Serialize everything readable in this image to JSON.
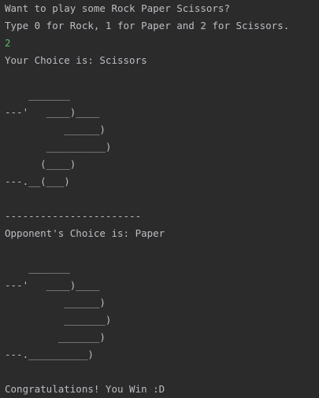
{
  "console": {
    "lines": [
      {
        "text": "Want to play some Rock Paper Scissors?",
        "kind": "output"
      },
      {
        "text": "Type 0 for Rock, 1 for Paper and 2 for Scissors.",
        "kind": "output"
      },
      {
        "text": "2",
        "kind": "input"
      },
      {
        "text": "Your Choice is: Scissors",
        "kind": "output"
      },
      {
        "text": "",
        "kind": "output"
      },
      {
        "text": "    _______",
        "kind": "output"
      },
      {
        "text": "---'   ____)____",
        "kind": "output"
      },
      {
        "text": "          ______)",
        "kind": "output"
      },
      {
        "text": "       __________)",
        "kind": "output"
      },
      {
        "text": "      (____)",
        "kind": "output"
      },
      {
        "text": "---.__(___)",
        "kind": "output"
      },
      {
        "text": "",
        "kind": "output"
      },
      {
        "text": "-----------------------",
        "kind": "output"
      },
      {
        "text": "Opponent's Choice is: Paper",
        "kind": "output"
      },
      {
        "text": "",
        "kind": "output"
      },
      {
        "text": "    _______",
        "kind": "output"
      },
      {
        "text": "---'   ____)____",
        "kind": "output"
      },
      {
        "text": "          ______)",
        "kind": "output"
      },
      {
        "text": "          _______)",
        "kind": "output"
      },
      {
        "text": "         _______)",
        "kind": "output"
      },
      {
        "text": "---.__________)",
        "kind": "output"
      },
      {
        "text": "",
        "kind": "output"
      },
      {
        "text": "Congratulations! You Win :D",
        "kind": "output"
      }
    ]
  }
}
